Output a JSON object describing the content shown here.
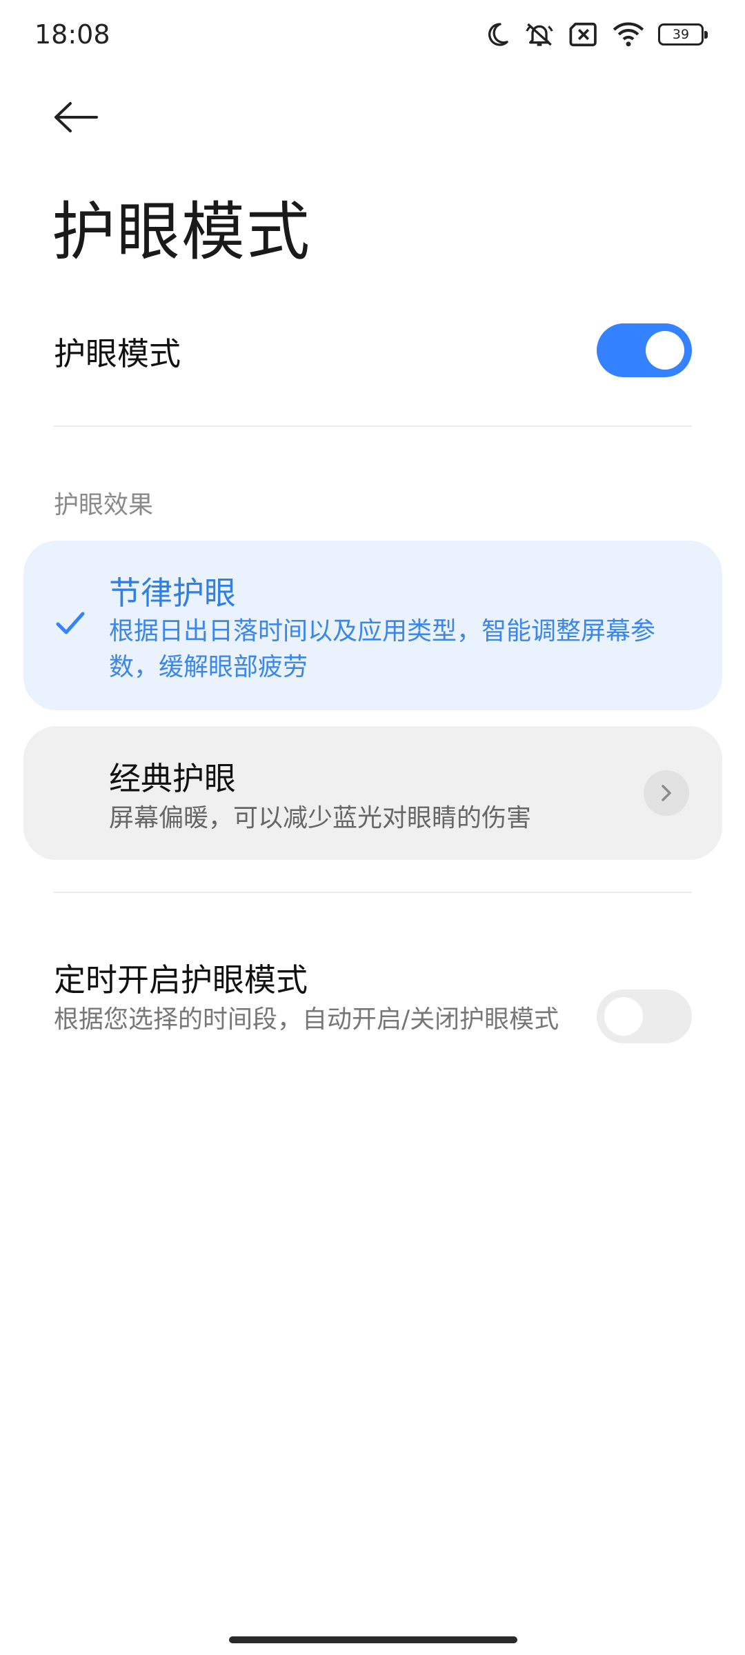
{
  "status_bar": {
    "time": "18:08",
    "battery": "39",
    "icons": [
      "moon-icon",
      "muted-bell-icon",
      "no-sim-icon",
      "wifi-icon",
      "battery-icon"
    ]
  },
  "header": {
    "back_icon": "arrow-left-icon",
    "title": "护眼模式"
  },
  "main_toggle": {
    "label": "护眼模式",
    "enabled": true
  },
  "effects": {
    "section_label": "护眼效果",
    "options": [
      {
        "title": "节律护眼",
        "description": "根据日出日落时间以及应用类型，智能调整屏幕参数，缓解眼部疲劳",
        "selected": true,
        "icon": "check-icon"
      },
      {
        "title": "经典护眼",
        "description": "屏幕偏暖，可以减少蓝光对眼睛的伤害",
        "selected": false,
        "icon": "chevron-right-icon"
      }
    ]
  },
  "schedule": {
    "title": "定时开启护眼模式",
    "description": "根据您选择的时间段，自动开启/关闭护眼模式",
    "enabled": false
  },
  "colors": {
    "accent": "#3482ff",
    "selected_card_bg": "#eaf2fe",
    "card_bg": "#f0f0f0",
    "toggle_off": "#ececec"
  }
}
